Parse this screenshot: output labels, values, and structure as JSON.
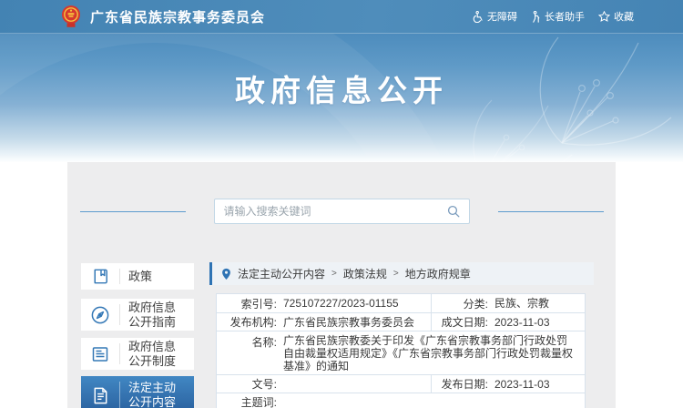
{
  "topbar": {
    "site_title": "广东省民族宗教事务委员会",
    "links": [
      {
        "label": "无障碍",
        "icon": "wheelchair-icon"
      },
      {
        "label": "长者助手",
        "icon": "elder-icon"
      },
      {
        "label": "收藏",
        "icon": "star-icon"
      }
    ]
  },
  "banner": {
    "title": "政府信息公开"
  },
  "search": {
    "placeholder": "请输入搜索关键词",
    "icon": "search-icon"
  },
  "sidebar": {
    "items": [
      {
        "label": "政策",
        "icon": "book-icon",
        "active": false
      },
      {
        "label": "政府信息公开指南",
        "icon": "compass-icon",
        "active": false
      },
      {
        "label": "政府信息公开制度",
        "icon": "document-list-icon",
        "active": false
      },
      {
        "label": "法定主动公开内容",
        "icon": "document-icon",
        "active": true
      }
    ]
  },
  "breadcrumb": {
    "separator": ">",
    "items": [
      "法定主动公开内容",
      "政策法规",
      "地方政府规章"
    ]
  },
  "detail_table": {
    "rows": [
      {
        "cells": [
          {
            "label": "索引号:",
            "value": "725107227/2023-01155"
          },
          {
            "label": "分类:",
            "value": "民族、宗教"
          }
        ]
      },
      {
        "cells": [
          {
            "label": "发布机构:",
            "value": "广东省民族宗教事务委员会"
          },
          {
            "label": "成文日期:",
            "value": "2023-11-03"
          }
        ]
      },
      {
        "cells": [
          {
            "label": "名称:",
            "value": "广东省民族宗教委关于印发《广东省宗教事务部门行政处罚自由裁量权适用规定》《广东省宗教事务部门行政处罚裁量权基准》的通知"
          }
        ]
      },
      {
        "cells": [
          {
            "label": "文号:",
            "value": ""
          },
          {
            "label": "发布日期:",
            "value": "2023-11-03"
          }
        ]
      },
      {
        "cells": [
          {
            "label": "主题词:",
            "value": ""
          }
        ]
      }
    ]
  },
  "colors": {
    "topbar_blue": "#4584b4",
    "banner_top_blue": "#4d8cbd",
    "active_item_blue": "#2e6fae",
    "accent_blue": "#2e73b4",
    "card_gray": "#ededee"
  }
}
